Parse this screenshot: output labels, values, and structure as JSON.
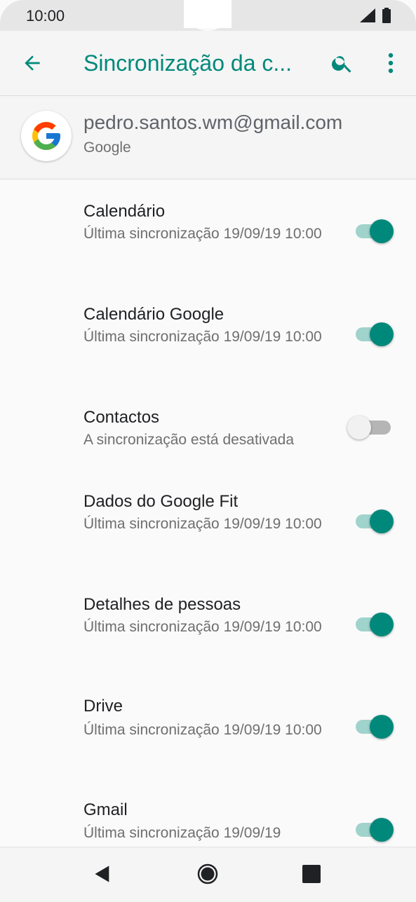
{
  "status_bar": {
    "time": "10:00"
  },
  "app_bar": {
    "title": "Sincronização da c..."
  },
  "account": {
    "email": "pedro.santos.wm@gmail.com",
    "type": "Google"
  },
  "sync_items": [
    {
      "title": "Calendário",
      "subtitle": "Última sincronização 19/09/19 10:00",
      "enabled": true
    },
    {
      "title": "Calendário Google",
      "subtitle": "Última sincronização 19/09/19 10:00",
      "enabled": true
    },
    {
      "title": "Contactos",
      "subtitle": "A sincronização está desativada",
      "enabled": false
    },
    {
      "title": "Dados do Google Fit",
      "subtitle": "Última sincronização 19/09/19 10:00",
      "enabled": true
    },
    {
      "title": "Detalhes de pessoas",
      "subtitle": "Última sincronização 19/09/19 10:00",
      "enabled": true
    },
    {
      "title": "Drive",
      "subtitle": "Última sincronização 19/09/19 10:00",
      "enabled": true
    },
    {
      "title": "Gmail",
      "subtitle": "Última sincronização 19/09/19",
      "enabled": true
    }
  ],
  "colors": {
    "accent": "#00897b",
    "track_on": "#9fd3cc"
  },
  "icons": {
    "back": "arrow-back-icon",
    "search": "search-icon",
    "menu": "more-vert-icon",
    "avatar": "google-logo-icon"
  }
}
